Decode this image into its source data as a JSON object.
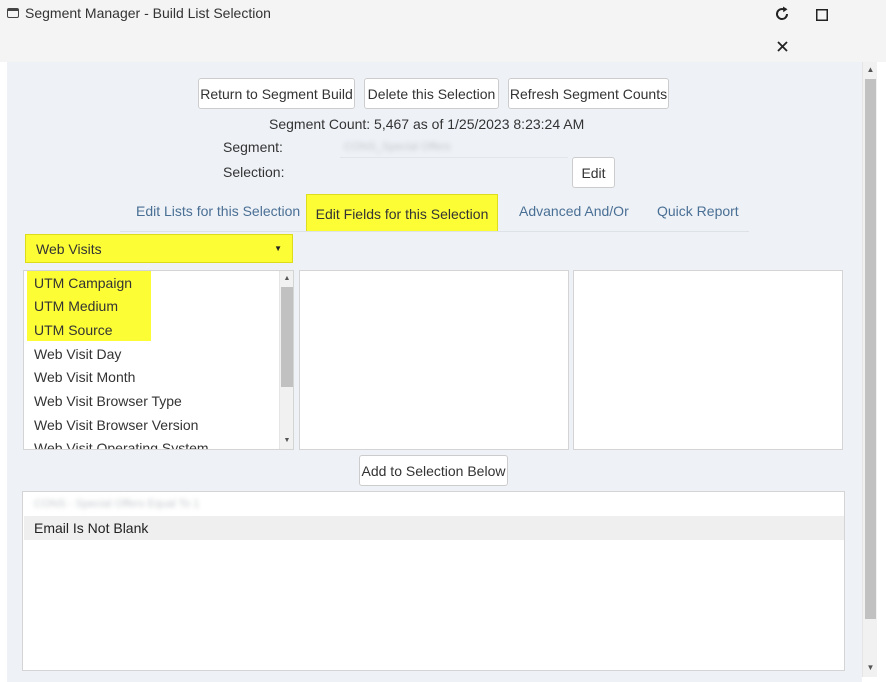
{
  "window": {
    "title": "Segment Manager - Build List Selection"
  },
  "toolbar": {
    "return_label": "Return to Segment Build",
    "delete_label": "Delete this Selection",
    "refresh_label": "Refresh Segment Counts"
  },
  "segment": {
    "count_text": "Segment Count: 5,467 as of 1/25/2023 8:23:24 AM",
    "segment_label": "Segment:",
    "segment_value": "CONS_Special Offers",
    "selection_label": "Selection:",
    "edit_label": "Edit"
  },
  "tabs": [
    {
      "label": "Edit Lists for this Selection",
      "active": false
    },
    {
      "label": "Edit Fields for this Selection",
      "active": true
    },
    {
      "label": "Advanced And/Or",
      "active": false
    },
    {
      "label": "Quick Report",
      "active": false
    }
  ],
  "dropdown": {
    "selected": "Web Visits"
  },
  "fields": [
    {
      "label": "UTM Campaign",
      "highlighted": true
    },
    {
      "label": "UTM Medium",
      "highlighted": true
    },
    {
      "label": "UTM Source",
      "highlighted": true
    },
    {
      "label": "Web Visit Day",
      "highlighted": false
    },
    {
      "label": "Web Visit Month",
      "highlighted": false
    },
    {
      "label": "Web Visit Browser Type",
      "highlighted": false
    },
    {
      "label": "Web Visit Browser Version",
      "highlighted": false
    },
    {
      "label": "Web Visit Operating System",
      "highlighted": false
    }
  ],
  "add_button": {
    "label": "Add to Selection Below"
  },
  "selection_rows": [
    {
      "text": "CONS - Special Offers Equal To 1"
    },
    {
      "text": "Email Is Not Blank"
    }
  ],
  "colors": {
    "highlight": "#fdfd36",
    "link": "#4a6f94",
    "panel_bg": "#eef2f7"
  },
  "icons": {
    "window": "window-icon",
    "refresh": "refresh-icon",
    "maximize": "maximize-icon",
    "close": "close-icon",
    "dropdown": "caret-down-icon"
  }
}
